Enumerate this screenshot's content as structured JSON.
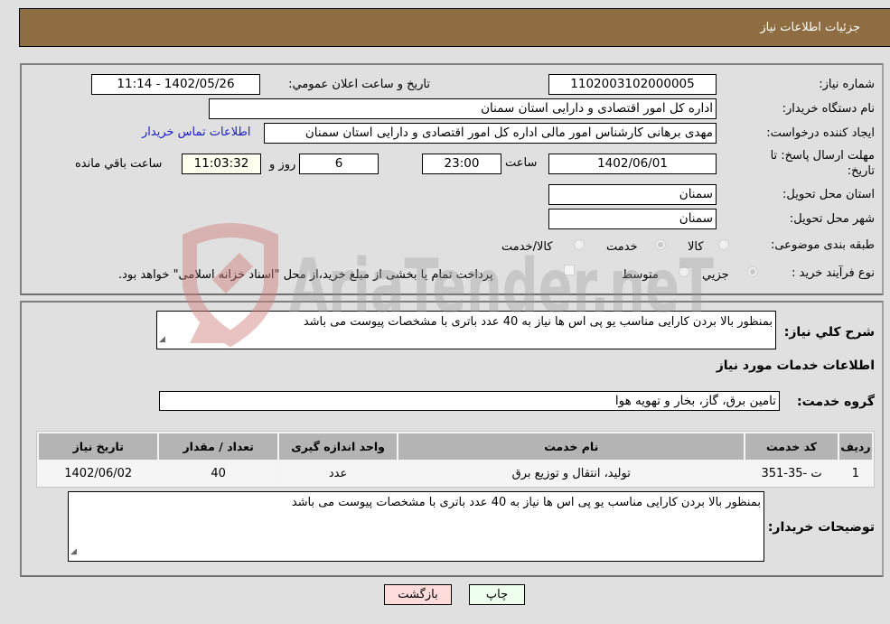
{
  "header": {
    "title": "جزئیات اطلاعات نیاز"
  },
  "details": {
    "need_number_label": "شماره نیاز:",
    "need_number": "1102003102000005",
    "announce_label": "تاریخ و ساعت اعلان عمومي:",
    "announce_value": "1402/05/26 - 11:14",
    "buyer_org_label": "نام دستگاه خریدار:",
    "buyer_org": "اداره کل امور اقتصادی و دارایی استان سمنان",
    "creator_label": "ایجاد کننده درخواست:",
    "creator": "مهدی برهانی کارشناس امور مالی اداره کل امور اقتصادی و دارایی استان سمنان",
    "contact_link": "اطلاعات تماس خریدار",
    "deadline_label_1": "مهلت ارسال پاسخ: تا",
    "deadline_label_2": "تاریخ:",
    "deadline_date": "1402/06/01",
    "time_label": "ساعت",
    "deadline_time": "23:00",
    "days": "6",
    "days_label": "روز و",
    "remaining_time": "11:03:32",
    "remaining_label": "ساعت باقي مانده",
    "province_label": "استان محل تحویل:",
    "province": "سمنان",
    "city_label": "شهر محل تحویل:",
    "city": "سمنان",
    "category_label": "طبقه بندی موضوعی:",
    "category_options": [
      {
        "label": "کالا",
        "selected": false
      },
      {
        "label": "خدمت",
        "selected": true
      },
      {
        "label": "کالا/خدمت",
        "selected": false
      }
    ],
    "process_label": "نوع فرآیند خرید :",
    "process_options": [
      {
        "label": "جزيي",
        "selected": true
      },
      {
        "label": "متوسط",
        "selected": false
      }
    ],
    "treasury_note": "پرداخت تمام یا بخشی از مبلغ خرید،از محل \"اسناد خزانه اسلامی\" خواهد بود.",
    "treasury_checked": false
  },
  "description": {
    "label": "شرح کلي نیاز:",
    "text": "بمنظور بالا بردن کارایی مناسب یو پی اس ها نیاز به 40 عدد باتری با مشخصات پیوست می باشد"
  },
  "services": {
    "section_title": "اطلاعات خدمات مورد نیاز",
    "group_label": "گروه خدمت:",
    "group_value": "تامین برق، گاز، بخار و تهویه هوا",
    "table": {
      "headers": [
        "ردیف",
        "کد خدمت",
        "نام خدمت",
        "واحد اندازه گیری",
        "تعداد / مقدار",
        "تاریخ نیاز"
      ],
      "rows": [
        [
          "1",
          "ت -35-351",
          "تولید، انتقال و توزیع برق",
          "عدد",
          "40",
          "1402/06/02"
        ]
      ]
    }
  },
  "buyer_notes": {
    "label": "توضیحات خریدار:",
    "text": "بمنظور بالا بردن کارایی مناسب یو پی اس ها نیاز به 40 عدد باتری با مشخصات پیوست می باشد"
  },
  "buttons": {
    "print": "چاپ",
    "back": "بازگشت"
  },
  "watermark": {
    "text": "AriaTender.neT",
    "color": "#d9a0a0"
  }
}
